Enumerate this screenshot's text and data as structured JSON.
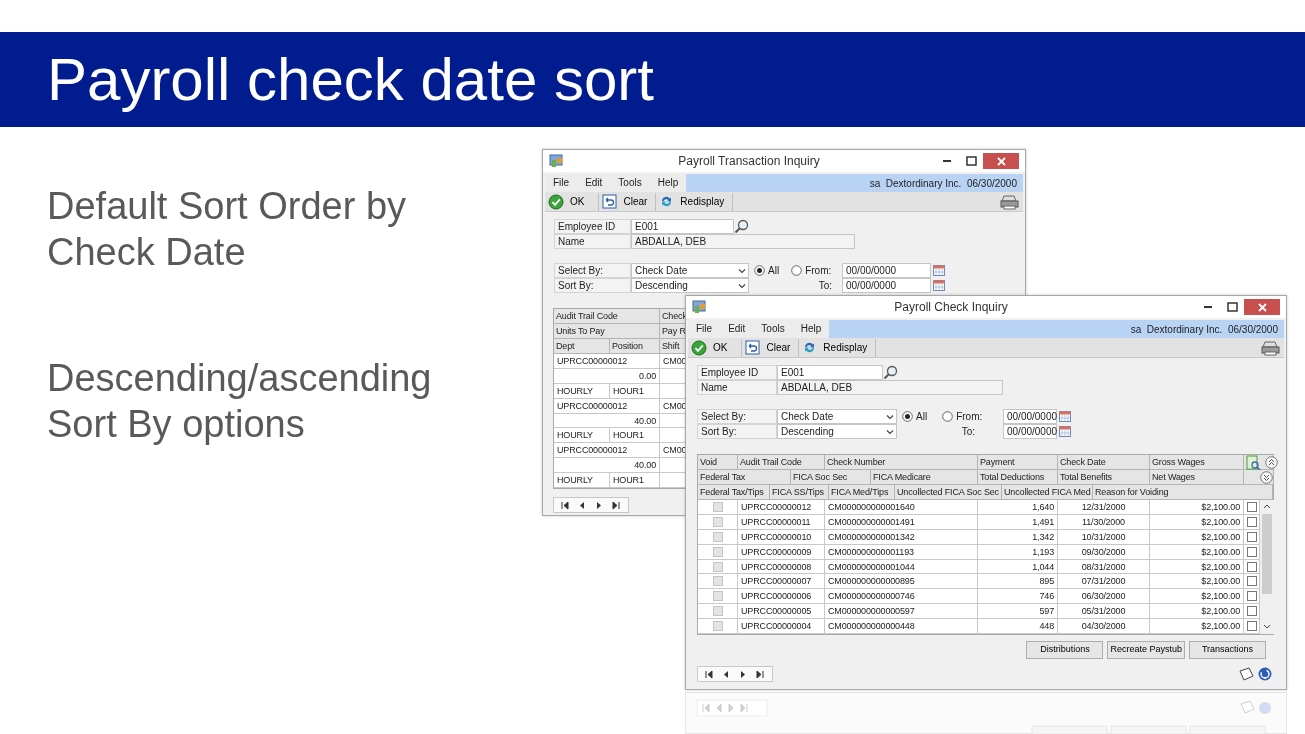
{
  "slide": {
    "title": "Payroll check date sort",
    "bullets": [
      "Default Sort Order by Check Date",
      "Descending/ascending Sort By options"
    ]
  },
  "back_window": {
    "title": "Payroll Transaction Inquiry",
    "menu": [
      "File",
      "Edit",
      "Tools",
      "Help"
    ],
    "company": "sa  Dextordinary Inc.  06/30/2000",
    "toolbar": [
      {
        "kind": "ok",
        "label": "OK"
      },
      {
        "kind": "clear",
        "label": "Clear"
      },
      {
        "kind": "redisplay",
        "label": "Redisplay"
      }
    ],
    "employee_id_label": "Employee ID",
    "employee_id": "E001",
    "name_label": "Name",
    "name": "ABDALLA, DEB",
    "select_by_label": "Select By:",
    "select_by": "Check Date",
    "sort_by_label": "Sort By:",
    "sort_by": "Descending",
    "radios": [
      {
        "label": "All",
        "selected": true
      },
      {
        "label": "From:",
        "selected": false
      }
    ],
    "to_label": "To:",
    "from_date": "00/00/0000",
    "to_date": "00/00/0000",
    "grid_header": [
      [
        "Audit Trail Code",
        "Check"
      ],
      [
        "Units To Pay",
        "Pay R"
      ],
      [
        "Dept",
        "Position",
        "Shift"
      ]
    ],
    "records": [
      {
        "audit_trail_code": "UPRCC00000012",
        "check": "CM00",
        "units": "0.00",
        "dept": "HOURLY",
        "position": "HOUR1"
      },
      {
        "audit_trail_code": "UPRCC00000012",
        "check": "CM00",
        "units": "40.00",
        "dept": "HOURLY",
        "position": "HOUR1"
      },
      {
        "audit_trail_code": "UPRCC00000012",
        "check": "CM00",
        "units": "40.00",
        "dept": "HOURLY",
        "position": "HOUR1"
      }
    ]
  },
  "front_window": {
    "title": "Payroll Check Inquiry",
    "menu": [
      "File",
      "Edit",
      "Tools",
      "Help"
    ],
    "company": "sa  Dextordinary Inc.  06/30/2000",
    "toolbar": [
      {
        "kind": "ok",
        "label": "OK"
      },
      {
        "kind": "clear",
        "label": "Clear"
      },
      {
        "kind": "redisplay",
        "label": "Redisplay"
      }
    ],
    "employee_id_label": "Employee ID",
    "employee_id": "E001",
    "name_label": "Name",
    "name": "ABDALLA, DEB",
    "select_by_label": "Select By:",
    "select_by": "Check Date",
    "sort_by_label": "Sort By:",
    "sort_by": "Descending",
    "radios": [
      {
        "label": "All",
        "selected": true
      },
      {
        "label": "From:",
        "selected": false
      }
    ],
    "to_label": "To:",
    "from_date": "00/00/0000",
    "to_date": "00/00/0000",
    "grid_header": [
      [
        "Void",
        "Audit Trail Code",
        "Check Number",
        "Payment",
        "Check Date",
        "Gross Wages"
      ],
      [
        "Federal Tax",
        "FICA Soc Sec",
        "FICA Medicare",
        "Total Deductions",
        "Total Benefits",
        "Net Wages"
      ],
      [
        "Federal Tax/Tips",
        "FICA SS/Tips",
        "FICA Med/Tips",
        "Uncollected FICA Soc Sec",
        "Uncollected FICA Med",
        "Reason for Voiding"
      ]
    ],
    "rows": [
      {
        "void": false,
        "audit_trail_code": "UPRCC00000012",
        "check_number": "CM000000000001640",
        "payment": "1,640",
        "check_date": "12/31/2000",
        "gross_wages": "$2,100.00",
        "marked": false
      },
      {
        "void": false,
        "audit_trail_code": "UPRCC00000011",
        "check_number": "CM000000000001491",
        "payment": "1,491",
        "check_date": "11/30/2000",
        "gross_wages": "$2,100.00",
        "marked": false
      },
      {
        "void": false,
        "audit_trail_code": "UPRCC00000010",
        "check_number": "CM000000000001342",
        "payment": "1,342",
        "check_date": "10/31/2000",
        "gross_wages": "$2,100.00",
        "marked": false
      },
      {
        "void": false,
        "audit_trail_code": "UPRCC00000009",
        "check_number": "CM000000000001193",
        "payment": "1,193",
        "check_date": "09/30/2000",
        "gross_wages": "$2,100.00",
        "marked": false
      },
      {
        "void": false,
        "audit_trail_code": "UPRCC00000008",
        "check_number": "CM000000000001044",
        "payment": "1,044",
        "check_date": "08/31/2000",
        "gross_wages": "$2,100.00",
        "marked": false
      },
      {
        "void": false,
        "audit_trail_code": "UPRCC00000007",
        "check_number": "CM000000000000895",
        "payment": "895",
        "check_date": "07/31/2000",
        "gross_wages": "$2,100.00",
        "marked": false
      },
      {
        "void": false,
        "audit_trail_code": "UPRCC00000006",
        "check_number": "CM000000000000746",
        "payment": "746",
        "check_date": "06/30/2000",
        "gross_wages": "$2,100.00",
        "marked": false
      },
      {
        "void": false,
        "audit_trail_code": "UPRCC00000005",
        "check_number": "CM000000000000597",
        "payment": "597",
        "check_date": "05/31/2000",
        "gross_wages": "$2,100.00",
        "marked": false
      },
      {
        "void": false,
        "audit_trail_code": "UPRCC00000004",
        "check_number": "CM000000000000448",
        "payment": "448",
        "check_date": "04/30/2000",
        "gross_wages": "$2,100.00",
        "marked": false
      }
    ],
    "buttons": [
      "Distributions",
      "Recreate Paystub",
      "Transactions"
    ]
  }
}
